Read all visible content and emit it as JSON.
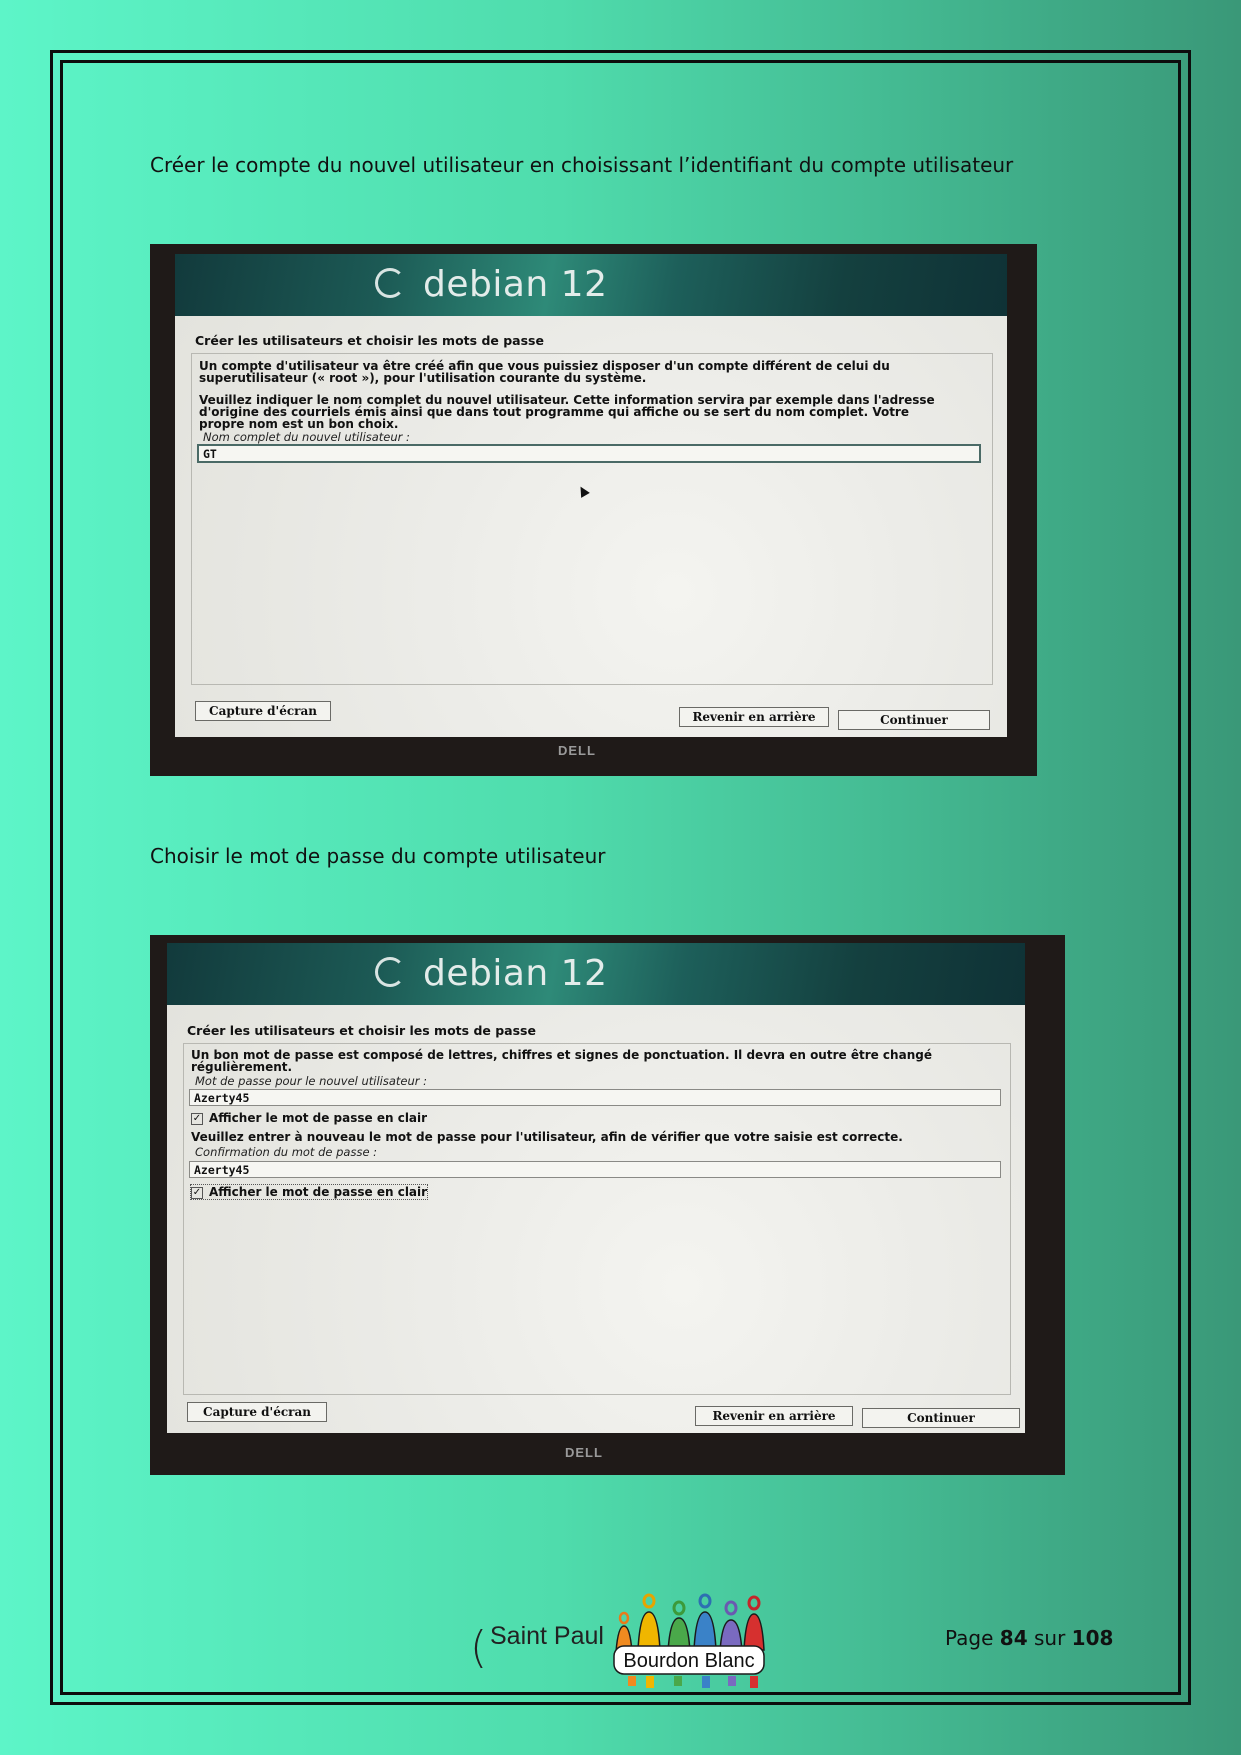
{
  "step1": {
    "caption": "Créer le compte du nouvel utilisateur en choisissant l’identifiant du compte utilisateur",
    "brand": "debian 12",
    "dialog_title": "Créer les utilisateurs et choisir les mots de passe",
    "para1_line1": "Un compte d'utilisateur va être créé afin que vous puissiez disposer d'un compte différent de celui du",
    "para1_line2": "superutilisateur (« root »), pour l'utilisation courante du système.",
    "para2_line1": "Veuillez indiquer le nom complet du nouvel utilisateur. Cette information servira par exemple dans l'adresse",
    "para2_line2": "d'origine des courriels émis ainsi que dans tout programme qui affiche ou se sert du nom complet. Votre",
    "para2_line3": "propre nom est un bon choix.",
    "field_label": "Nom complet du nouvel utilisateur :",
    "field_value": "GT",
    "screenshot_button": "Capture d'écran",
    "back_button": "Revenir en arrière",
    "continue_button": "Continuer",
    "bezel_brand": "DELL"
  },
  "step2": {
    "caption": "Choisir le mot de passe du compte utilisateur",
    "brand": "debian 12",
    "dialog_title": "Créer les utilisateurs et choisir les mots de passe",
    "intro_line1": "Un bon mot de passe est composé de lettres, chiffres et signes de ponctuation. Il devra en outre être changé",
    "intro_line2": "régulièrement.",
    "password_label": "Mot de passe pour le nouvel utilisateur :",
    "password_value": "Azerty45",
    "show_password_1": "Afficher le mot de passe en clair",
    "confirm_intro": "Veuillez entrer à nouveau le mot de passe pour l'utilisateur, afin de vérifier que votre saisie est correcte.",
    "confirm_label": "Confirmation du mot de passe :",
    "confirm_value": "Azerty45",
    "show_password_2": "Afficher le mot de passe en clair",
    "check_glyph": "✓",
    "screenshot_button": "Capture d'écran",
    "back_button": "Revenir en arrière",
    "continue_button": "Continuer",
    "bezel_brand": "DELL"
  },
  "footer": {
    "paren": "(",
    "school_name": "Saint Paul",
    "logo_text": "Bourdon Blanc",
    "page_prefix": "Page",
    "page_current": "84",
    "page_sep": "sur",
    "page_total": "108"
  }
}
